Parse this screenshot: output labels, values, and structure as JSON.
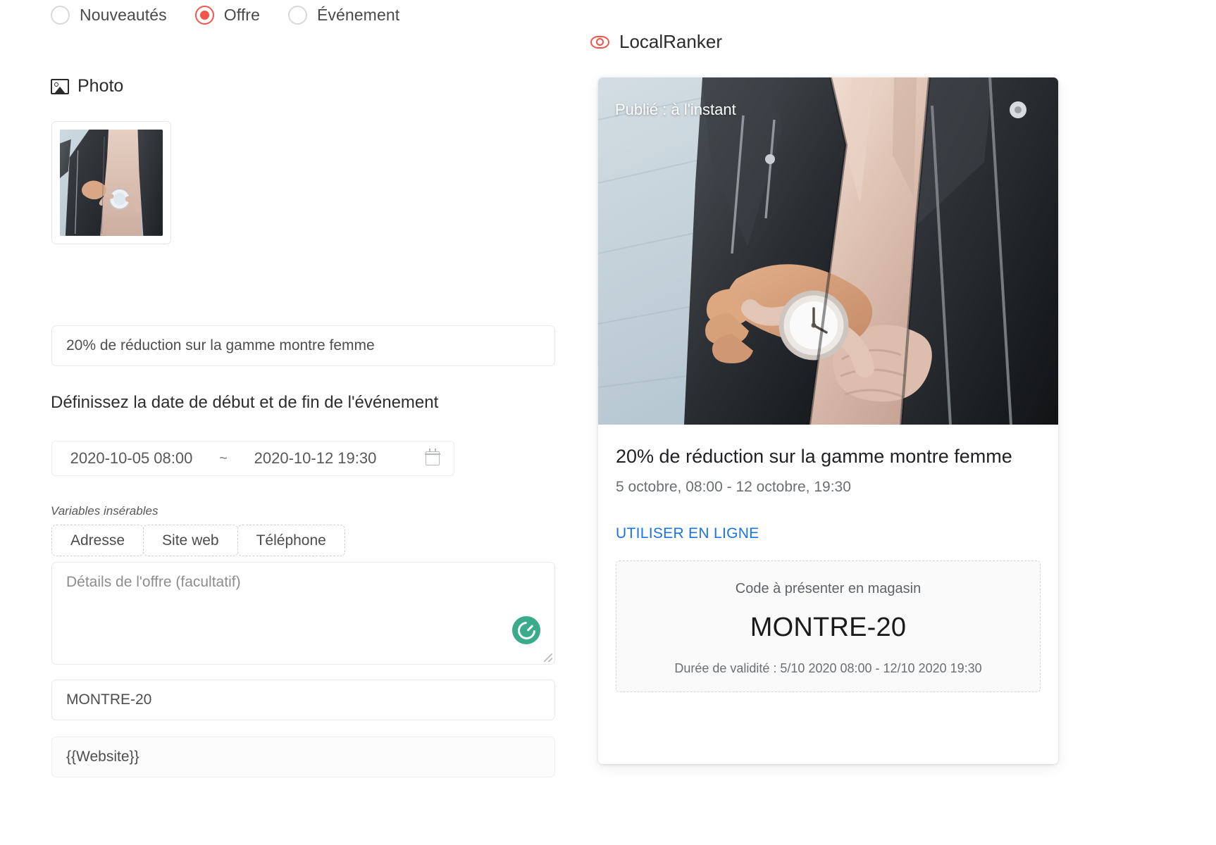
{
  "post_types": {
    "options": [
      {
        "label": "Nouveautés",
        "selected": false
      },
      {
        "label": "Offre",
        "selected": true
      },
      {
        "label": "Événement",
        "selected": false
      }
    ]
  },
  "photo_section": {
    "label": "Photo",
    "icon": "image-icon",
    "thumbnail_alt": "montre femme"
  },
  "form": {
    "title_value": "20% de réduction sur la gamme montre femme",
    "date_section_label": "Définissez la date de début et de fin de l'événement",
    "date_start": "2020-10-05 08:00",
    "date_separator": "~",
    "date_end": "2020-10-12 19:30",
    "calendar_icon": "calendar-icon",
    "variables_label": "Variables insérables",
    "variables": [
      {
        "label": "Adresse"
      },
      {
        "label": "Site web"
      },
      {
        "label": "Téléphone"
      }
    ],
    "details_placeholder": "Détails de l'offre (facultatif)",
    "details_value": "",
    "grammarly_icon": "grammarly-icon",
    "code_value": "MONTRE-20",
    "website_value": "{{Website}}"
  },
  "preview": {
    "brand": "LocalRanker",
    "brand_icon": "eye-icon",
    "published_label": "Publié : à l'instant",
    "title": "20% de réduction sur la gamme montre femme",
    "dates": "5 octobre, 08:00 - 12 octobre, 19:30",
    "cta": "UTILISER EN LIGNE",
    "coupon": {
      "caption": "Code à présenter en magasin",
      "code": "MONTRE-20",
      "validity": "Durée de validité : 5/10 2020 08:00 - 12/10 2020 19:30"
    }
  },
  "colors": {
    "accent_red": "#f4554a",
    "link_blue": "#1a73e8",
    "grammarly_green": "#3aab8b",
    "text_dark": "#2b2b2b",
    "text_muted": "#6b6f73"
  }
}
